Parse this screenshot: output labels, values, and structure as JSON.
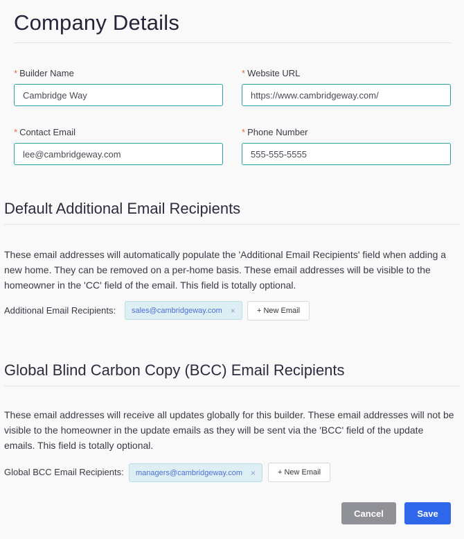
{
  "company": {
    "title": "Company Details",
    "fields": [
      {
        "label": "Builder Name",
        "value": "Cambridge Way",
        "required": "*"
      },
      {
        "label": "Website URL",
        "value": "https://www.cambridgeway.com/",
        "required": "*"
      },
      {
        "label": "Contact Email",
        "value": "lee@cambridgeway.com",
        "required": "*"
      },
      {
        "label": "Phone Number",
        "value": "555-555-5555",
        "required": "*"
      }
    ]
  },
  "additional": {
    "title": "Default Additional Email Recipients",
    "description": "These email addresses will automatically populate the 'Additional Email Recipients' field when adding a new home. They can be removed on a per-home basis. These email addresses will be visible to the homeowner in the 'CC' field of the email. This field is totally optional.",
    "row_label": "Additional Email Recipients:",
    "tags": [
      "sales@cambridgeway.com"
    ],
    "remove_glyph": "×",
    "new_email_label": "+ New Email"
  },
  "bcc": {
    "title": "Global Blind Carbon Copy (BCC) Email Recipients",
    "description": "These email addresses will receive all updates globally for this builder. These email addresses will not be visible to the homeowner in the update emails as they will be sent via the 'BCC' field of the update emails. This field is totally optional.",
    "row_label": "Global BCC Email Recipients:",
    "tags": [
      "managers@cambridgeway.com"
    ],
    "remove_glyph": "×",
    "new_email_label": "+ New Email"
  },
  "actions": {
    "cancel_label": "Cancel",
    "save_label": "Save"
  }
}
